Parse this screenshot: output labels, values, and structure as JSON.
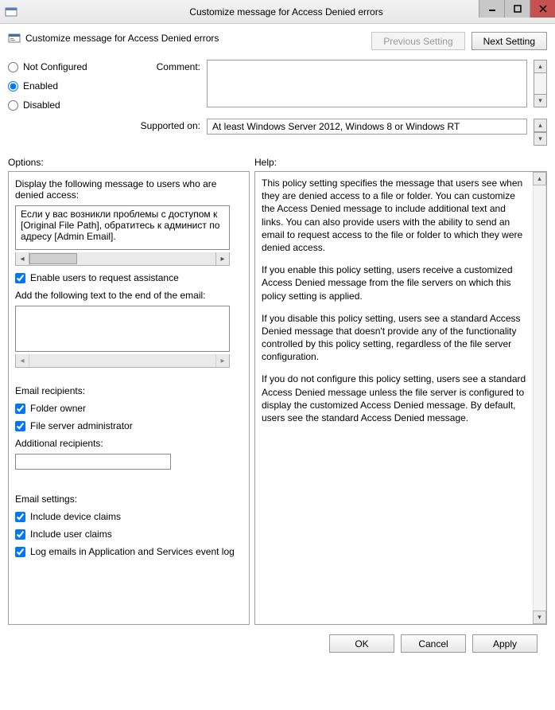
{
  "window": {
    "title": "Customize message for Access Denied errors"
  },
  "header": {
    "label": "Customize message for Access Denied errors",
    "prev_button": "Previous Setting",
    "next_button": "Next Setting"
  },
  "state": {
    "not_configured": "Not Configured",
    "enabled": "Enabled",
    "disabled": "Disabled",
    "selected": "enabled"
  },
  "config": {
    "comment_label": "Comment:",
    "comment_value": "",
    "supported_label": "Supported on:",
    "supported_value": "At least Windows Server 2012, Windows 8 or Windows RT"
  },
  "sections": {
    "options_label": "Options:",
    "help_label": "Help:"
  },
  "options": {
    "display_msg_label": "Display the following message to users who are denied access:",
    "display_msg_value": "Если у вас возникли проблемы с доступом к [Original File Path], обратитесь к админист по адресу [Admin Email].",
    "enable_assist_label": "Enable users to request assistance",
    "enable_assist_checked": true,
    "email_text_label": "Add the following text to the end of the email:",
    "email_text_value": "",
    "recipients_label": "Email recipients:",
    "folder_owner_label": "Folder owner",
    "folder_owner_checked": true,
    "fs_admin_label": "File server administrator",
    "fs_admin_checked": true,
    "additional_recipients_label": "Additional recipients:",
    "additional_recipients_value": "",
    "settings_label": "Email settings:",
    "device_claims_label": "Include device claims",
    "device_claims_checked": true,
    "user_claims_label": "Include user claims",
    "user_claims_checked": true,
    "log_emails_label": "Log emails in Application and Services event log",
    "log_emails_checked": true
  },
  "help": {
    "p1": "This policy setting specifies the message that users see when they are denied access to a file or folder. You can customize the Access Denied message to include additional text and links. You can also provide users with the ability to send an email to request access to the file or folder to which they were denied access.",
    "p2": "If you enable this policy setting, users receive a customized Access Denied message from the file servers on which this policy setting is applied.",
    "p3": "If you disable this policy setting, users see a standard Access Denied message that doesn't provide any of the functionality controlled by this policy setting, regardless of the file server configuration.",
    "p4": "If you do not configure this policy setting, users see a standard Access Denied message unless the file server is configured to display the customized Access Denied message. By default, users see the standard Access Denied message."
  },
  "footer": {
    "ok": "OK",
    "cancel": "Cancel",
    "apply": "Apply"
  }
}
